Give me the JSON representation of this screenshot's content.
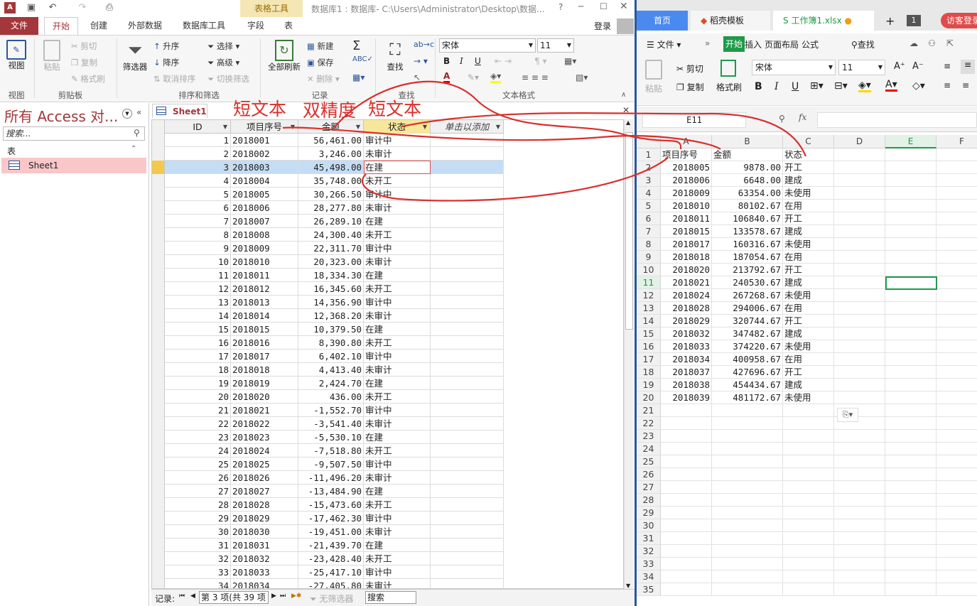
{
  "access": {
    "title": "数据库1 : 数据库- C:\\Users\\Administrator\\Desktop\\数据...",
    "context_tab": "表格工具",
    "login": "登录",
    "help": "?",
    "tabs": [
      "文件",
      "开始",
      "创建",
      "外部数据",
      "数据库工具",
      "字段",
      "表"
    ],
    "ribbon": {
      "view": {
        "label": "视图",
        "group": "视图"
      },
      "clipboard": {
        "paste": "粘贴",
        "cut": "剪切",
        "copy": "复制",
        "format_painter": "格式刷",
        "group": "剪贴板"
      },
      "sort_filter": {
        "filter": "筛选器",
        "asc": "升序",
        "desc": "降序",
        "remove_sort": "取消排序",
        "selection": "选择",
        "advanced": "高级",
        "toggle_filter": "切换筛选",
        "group": "排序和筛选"
      },
      "records": {
        "refresh_all": "全部刷新",
        "new": "新建",
        "save": "保存",
        "delete": "删除",
        "totals": "Σ",
        "group": "记录"
      },
      "find": {
        "find": "查找",
        "group": "查找"
      },
      "text_format": {
        "font": "宋体",
        "size": "11",
        "bold": "B",
        "italic": "I",
        "underline": "U",
        "group": "文本格式"
      }
    },
    "nav": {
      "title": "所有 Access 对...",
      "search_placeholder": "搜索...",
      "section": "表",
      "item": "Sheet1"
    },
    "doc_tab": "Sheet1",
    "columns": [
      "ID",
      "项目序号",
      "金额",
      "状态",
      "单击以添加"
    ],
    "rows": [
      [
        "1",
        "2018001",
        "56,461.00",
        "审计中"
      ],
      [
        "2",
        "2018002",
        "3,246.00",
        "未审计"
      ],
      [
        "3",
        "2018003",
        "45,498.00",
        "在建"
      ],
      [
        "4",
        "2018004",
        "35,748.00",
        "未开工"
      ],
      [
        "5",
        "2018005",
        "30,266.50",
        "审计中"
      ],
      [
        "6",
        "2018006",
        "28,277.80",
        "未审计"
      ],
      [
        "7",
        "2018007",
        "26,289.10",
        "在建"
      ],
      [
        "8",
        "2018008",
        "24,300.40",
        "未开工"
      ],
      [
        "9",
        "2018009",
        "22,311.70",
        "审计中"
      ],
      [
        "10",
        "2018010",
        "20,323.00",
        "未审计"
      ],
      [
        "11",
        "2018011",
        "18,334.30",
        "在建"
      ],
      [
        "12",
        "2018012",
        "16,345.60",
        "未开工"
      ],
      [
        "13",
        "2018013",
        "14,356.90",
        "审计中"
      ],
      [
        "14",
        "2018014",
        "12,368.20",
        "未审计"
      ],
      [
        "15",
        "2018015",
        "10,379.50",
        "在建"
      ],
      [
        "16",
        "2018016",
        "8,390.80",
        "未开工"
      ],
      [
        "17",
        "2018017",
        "6,402.10",
        "审计中"
      ],
      [
        "18",
        "2018018",
        "4,413.40",
        "未审计"
      ],
      [
        "19",
        "2018019",
        "2,424.70",
        "在建"
      ],
      [
        "20",
        "2018020",
        "436.00",
        "未开工"
      ],
      [
        "21",
        "2018021",
        "-1,552.70",
        "审计中"
      ],
      [
        "22",
        "2018022",
        "-3,541.40",
        "未审计"
      ],
      [
        "23",
        "2018023",
        "-5,530.10",
        "在建"
      ],
      [
        "24",
        "2018024",
        "-7,518.80",
        "未开工"
      ],
      [
        "25",
        "2018025",
        "-9,507.50",
        "审计中"
      ],
      [
        "26",
        "2018026",
        "-11,496.20",
        "未审计"
      ],
      [
        "27",
        "2018027",
        "-13,484.90",
        "在建"
      ],
      [
        "28",
        "2018028",
        "-15,473.60",
        "未开工"
      ],
      [
        "29",
        "2018029",
        "-17,462.30",
        "审计中"
      ],
      [
        "30",
        "2018030",
        "-19,451.00",
        "未审计"
      ],
      [
        "31",
        "2018031",
        "-21,439.70",
        "在建"
      ],
      [
        "32",
        "2018032",
        "-23,428.40",
        "未开工"
      ],
      [
        "33",
        "2018033",
        "-25,417.10",
        "审计中"
      ],
      [
        "34",
        "2018034",
        "-27,405.80",
        "未审计"
      ]
    ],
    "status": {
      "label": "记录:",
      "position": "第 3 项(共 39 项",
      "no_filter": "无筛选器",
      "search": "搜索"
    }
  },
  "annotations": {
    "label1": "短文本",
    "label2": "双精度",
    "label3": "短文本"
  },
  "wps": {
    "tabs": {
      "home": "首页",
      "template": "稻壳模板",
      "workbook": "工作簿1.xlsx",
      "plus": "+",
      "count": "1",
      "visitor": "访客登录"
    },
    "menu": {
      "file": "文件",
      "start": "开始",
      "insert": "插入",
      "layout": "页面布局",
      "formula": "公式",
      "find": "查找"
    },
    "toolbar": {
      "paste": "粘贴",
      "cut": "剪切",
      "copy": "复制",
      "format_painter": "格式刷",
      "font": "宋体",
      "size": "11",
      "bold": "B",
      "italic": "I",
      "underline": "U"
    },
    "name_box": "E11",
    "fx": "fx",
    "col_headers": [
      "A",
      "B",
      "C",
      "D",
      "E",
      "F"
    ],
    "header_row": [
      "项目序号",
      "金额",
      "状态"
    ],
    "rows": [
      [
        "2018005",
        "9878.00",
        "开工"
      ],
      [
        "2018006",
        "6648.00",
        "建成"
      ],
      [
        "2018009",
        "63354.00",
        "未使用"
      ],
      [
        "2018010",
        "80102.67",
        "在用"
      ],
      [
        "2018011",
        "106840.67",
        "开工"
      ],
      [
        "2018015",
        "133578.67",
        "建成"
      ],
      [
        "2018017",
        "160316.67",
        "未使用"
      ],
      [
        "2018018",
        "187054.67",
        "在用"
      ],
      [
        "2018020",
        "213792.67",
        "开工"
      ],
      [
        "2018021",
        "240530.67",
        "建成"
      ],
      [
        "2018024",
        "267268.67",
        "未使用"
      ],
      [
        "2018028",
        "294006.67",
        "在用"
      ],
      [
        "2018029",
        "320744.67",
        "开工"
      ],
      [
        "2018032",
        "347482.67",
        "建成"
      ],
      [
        "2018033",
        "374220.67",
        "未使用"
      ],
      [
        "2018034",
        "400958.67",
        "在用"
      ],
      [
        "2018037",
        "427696.67",
        "开工"
      ],
      [
        "2018038",
        "454434.67",
        "建成"
      ],
      [
        "2018039",
        "481172.67",
        "未使用"
      ]
    ],
    "row_numbers": [
      "1",
      "2",
      "3",
      "4",
      "5",
      "6",
      "7",
      "8",
      "9",
      "10",
      "11",
      "12",
      "13",
      "14",
      "15",
      "16",
      "17",
      "18",
      "19",
      "20",
      "21",
      "22",
      "23",
      "24",
      "25",
      "26",
      "27",
      "28",
      "29",
      "30",
      "31",
      "32",
      "33",
      "34",
      "35"
    ]
  }
}
